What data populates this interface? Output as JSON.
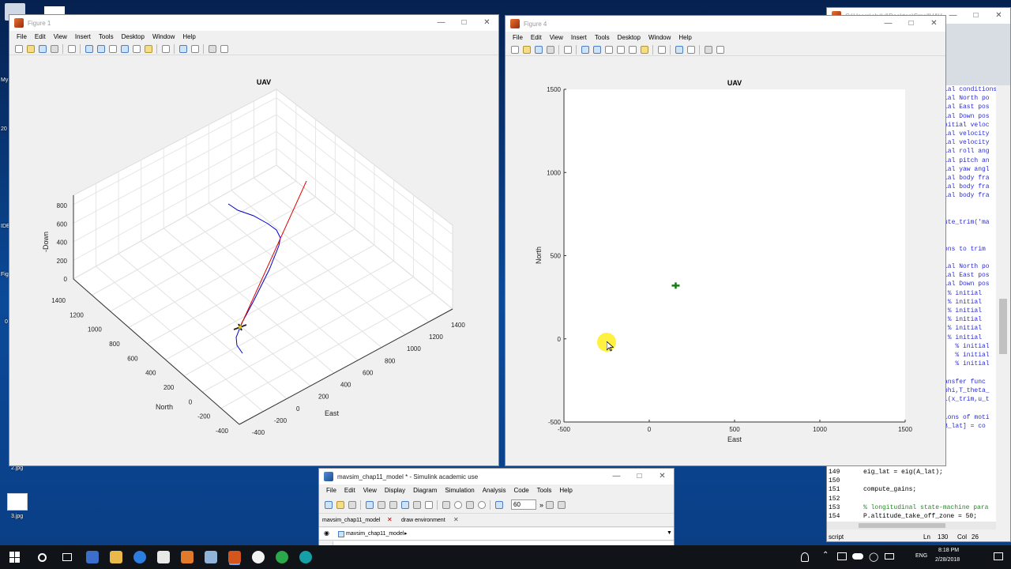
{
  "desktop": {
    "icon_labels": [
      "2.jpg",
      "3.jpg"
    ],
    "edge_labels": [
      "My",
      "20",
      "IDE",
      "Fig",
      "0"
    ]
  },
  "figure1": {
    "title": "Figure 1",
    "menu": [
      "File",
      "Edit",
      "View",
      "Insert",
      "Tools",
      "Desktop",
      "Window",
      "Help"
    ],
    "chart_data": {
      "type": "line3d",
      "title": "UAV",
      "xlabel": "East",
      "ylabel": "North",
      "zlabel": "-Down",
      "east_ticks": [
        "-400",
        "-200",
        "0",
        "200",
        "400",
        "600",
        "800",
        "1000",
        "1200",
        "1400"
      ],
      "north_ticks": [
        "-400",
        "-200",
        "0",
        "200",
        "400",
        "600",
        "800",
        "1000",
        "1200",
        "1400"
      ],
      "down_ticks": [
        "0",
        "200",
        "400",
        "600",
        "800"
      ],
      "grid": true,
      "series": [
        {
          "color": "#0000cc"
        },
        {
          "color": "#e00000"
        }
      ]
    }
  },
  "figure4": {
    "title": "Figure 4",
    "menu": [
      "File",
      "Edit",
      "View",
      "Insert",
      "Tools",
      "Desktop",
      "Window",
      "Help"
    ],
    "chart_data": {
      "type": "scatter",
      "title": "UAV",
      "xlabel": "East",
      "ylabel": "North",
      "xlim": [
        -500,
        1500
      ],
      "ylim": [
        -500,
        1500
      ],
      "x_ticks": [
        "-500",
        "0",
        "500",
        "1000",
        "1500"
      ],
      "y_ticks": [
        "-500",
        "0",
        "500",
        "1000",
        "1500"
      ],
      "points": [
        {
          "x": 155,
          "y": 320,
          "color": "#1a7a1a"
        }
      ]
    }
  },
  "editor": {
    "title": "C:\\Users\\abdul\\Desktop\\SmallUAV...",
    "code_lines": [
      "ial conditions",
      "ial North po",
      "ial East pos",
      "ial Down pos",
      "nitial veloc",
      "ial velocity",
      "ial velocity",
      "ial roll ang",
      "ial pitch an",
      "ial yaw angl",
      "ial body fra",
      "ial body fra",
      "ial body fra",
      "",
      "",
      "ute_trim('ma",
      "",
      "",
      "ons to trim",
      "",
      "ial North po",
      "ial East pos",
      "ial Down pos",
      " % initial",
      " % initial",
      " % initial",
      " % initial",
      " % initial",
      " % initial",
      ";  % initial",
      ";  % initial",
      ";  % initial",
      "",
      "ansfer func",
      "phi,T_theta_",
      "l(x_trim,u_t",
      "",
      "ions of moti",
      "B_lat] = co"
    ],
    "numbered_lines": [
      {
        "n": "149",
        "text": "eig_lat = eig(A_lat);"
      },
      {
        "n": "150",
        "text": ""
      },
      {
        "n": "151",
        "text": "compute_gains;"
      },
      {
        "n": "152",
        "text": ""
      },
      {
        "n": "153",
        "text": "% longitudinal state-machine para"
      },
      {
        "n": "154",
        "text": "P.altitude_take_off_zone = 50;"
      }
    ],
    "status": {
      "type": "script",
      "ln": "Ln",
      "ln_val": "130",
      "col": "Col",
      "col_val": "26"
    }
  },
  "simulink": {
    "title": "mavsim_chap11_model * - Simulink academic use",
    "menu": [
      "File",
      "Edit",
      "View",
      "Display",
      "Diagram",
      "Simulation",
      "Analysis",
      "Code",
      "Tools",
      "Help"
    ],
    "stop_time": "60",
    "tabs": [
      "mavsim_chap11_model",
      "draw environment"
    ],
    "breadcrumb": "mavsim_chap11_model"
  },
  "taskbar": {
    "time": "8:18 PM",
    "date": "2/28/2018",
    "lang": "ENG"
  }
}
